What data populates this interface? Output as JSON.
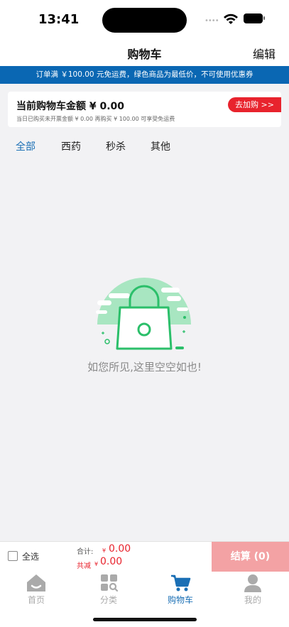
{
  "status_bar": {
    "time": "13:41",
    "signal": "••••"
  },
  "header": {
    "title": "购物车",
    "edit_label": "编辑"
  },
  "notice": {
    "text": "订单满 ￥100.00 元免运费，绿色商品为最低价，不可使用优惠券"
  },
  "cart_summary": {
    "current_amount_text": "当前购物车金额 ¥ 0.00",
    "sub_text": "当日已购买未开票金额 ¥ 0.00 再购买 ¥ 100.00 可享受免运费",
    "go_add_label": "去加购 >>"
  },
  "tabs": [
    {
      "label": "全部",
      "active": true
    },
    {
      "label": "西药",
      "active": false
    },
    {
      "label": "秒杀",
      "active": false
    },
    {
      "label": "其他",
      "active": false
    }
  ],
  "empty_state": {
    "text": "如您所见,这里空空如也!"
  },
  "action_bar": {
    "select_all_label": "全选",
    "total_label": "合计:",
    "currency_symbol": "¥",
    "total_value": "0.00",
    "discount_label": "共减",
    "discount_value": "0.00",
    "checkout_label": "结算 (0)"
  },
  "bottom_nav": [
    {
      "label": "首页",
      "icon": "home-icon",
      "active": false
    },
    {
      "label": "分类",
      "icon": "category-icon",
      "active": false
    },
    {
      "label": "购物车",
      "icon": "cart-icon",
      "active": true
    },
    {
      "label": "我的",
      "icon": "profile-icon",
      "active": false
    }
  ],
  "colors": {
    "brand_blue": "#0a67b3",
    "accent_red": "#e8232d",
    "checkout_disabled": "#f3a2a4",
    "empty_green": "#2bbf6a"
  }
}
